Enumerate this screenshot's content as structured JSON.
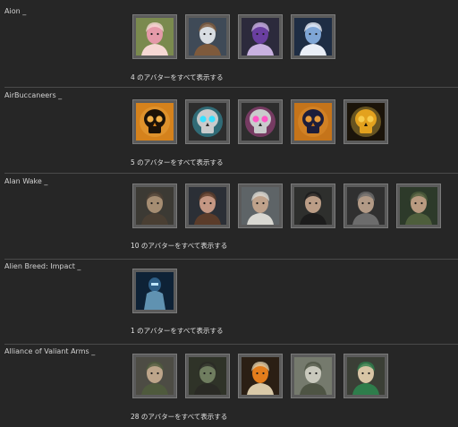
{
  "sections": [
    {
      "title": "Aion _",
      "show_all": "4 のアバターをすべて表示する",
      "avatars": [
        {
          "icon": "pink-haired-elf-avatar-icon",
          "bg": "#7a8a4e",
          "main": "#e59aa9",
          "accent": "#f6d8d4"
        },
        {
          "icon": "white-haired-warrior-avatar-icon",
          "bg": "#3f4a57",
          "main": "#d8dde2",
          "accent": "#7e5a3c"
        },
        {
          "icon": "purple-haired-woman-avatar-icon",
          "bg": "#2c2a3c",
          "main": "#6a3fa0",
          "accent": "#c9b2e1"
        },
        {
          "icon": "blue-demon-avatar-icon",
          "bg": "#1e2d44",
          "main": "#7fa6d6",
          "accent": "#e9eef7"
        }
      ]
    },
    {
      "title": "AirBuccaneers _",
      "show_all": "5 のアバターをすべて表示する",
      "avatars": [
        {
          "icon": "orange-skull-emblem-icon",
          "bg": "#d5821c",
          "main": "#1c1208",
          "accent": "#f3b24a"
        },
        {
          "icon": "cyan-eyed-skull-emblem-icon",
          "bg": "#2d2d2d",
          "main": "#c9cbcc",
          "accent": "#39e0ff"
        },
        {
          "icon": "pink-eyed-skull-emblem-icon",
          "bg": "#2d2d2d",
          "main": "#c9cbcc",
          "accent": "#ff56c5"
        },
        {
          "icon": "orange-octopus-skull-emblem-icon",
          "bg": "#c5741a",
          "main": "#1d1d3a",
          "accent": "#e89b3a"
        },
        {
          "icon": "gold-octopus-skull-emblem-icon",
          "bg": "#1b140a",
          "main": "#e3a21e",
          "accent": "#f7cc4d"
        }
      ]
    },
    {
      "title": "Alan Wake _",
      "show_all": "10 のアバターをすべて表示する",
      "avatars": [
        {
          "icon": "alan-wake-portrait-icon",
          "bg": "#3c3a34",
          "main": "#a58d72",
          "accent": "#4a3f33"
        },
        {
          "icon": "woman-portrait-icon",
          "bg": "#2b2f36",
          "main": "#c49783",
          "accent": "#5b3c2a"
        },
        {
          "icon": "man-white-shirt-portrait-icon",
          "bg": "#5e6467",
          "main": "#bfa28b",
          "accent": "#d9d8d2"
        },
        {
          "icon": "eyepatch-old-man-portrait-icon",
          "bg": "#2e2f2d",
          "main": "#bb9d86",
          "accent": "#1c1c1c"
        },
        {
          "icon": "old-man-portrait-icon",
          "bg": "#303030",
          "main": "#b29a86",
          "accent": "#6c6c6c"
        },
        {
          "icon": "man-green-jacket-portrait-icon",
          "bg": "#2d3a2a",
          "main": "#b99a80",
          "accent": "#4e5e3c"
        }
      ]
    },
    {
      "title": "Alien Breed: Impact _",
      "show_all": "1 のアバターをすべて表示する",
      "avatars": [
        {
          "icon": "armored-soldier-avatar-icon",
          "bg": "#0e2236",
          "main": "#6fa6c7",
          "accent": "#2e5f87"
        }
      ]
    },
    {
      "title": "Alliance of Valiant Arms _",
      "show_all": "28 のアバターをすべて表示する",
      "avatars": [
        {
          "icon": "soldier-beret-avatar-icon",
          "bg": "#4d4c44",
          "main": "#bda58a",
          "accent": "#4f5a3d"
        },
        {
          "icon": "gas-mask-soldier-avatar-icon",
          "bg": "#2f3328",
          "main": "#6f7d5f",
          "accent": "#2a2a25"
        },
        {
          "icon": "pumpkin-head-soldier-avatar-icon",
          "bg": "#2b1f14",
          "main": "#e37d1c",
          "accent": "#d9c9a8"
        },
        {
          "icon": "camo-soldier-avatar-icon",
          "bg": "#757a6d",
          "main": "#c9c9bd",
          "accent": "#4e5444"
        },
        {
          "icon": "masked-woman-avatar-icon",
          "bg": "#3b3f36",
          "main": "#d8c5a5",
          "accent": "#2e7d4b"
        }
      ]
    }
  ]
}
